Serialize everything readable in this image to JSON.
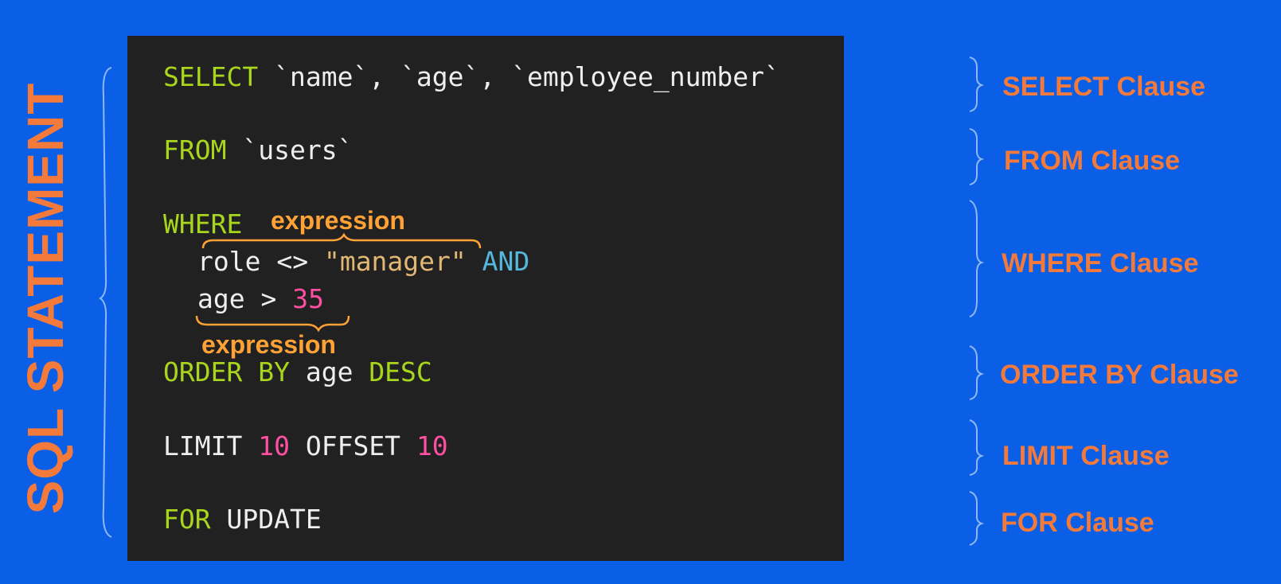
{
  "side_title": "SQL STATEMENT",
  "code": {
    "select": {
      "kw": "SELECT",
      "cols": "`name`, `age`, `employee_number`"
    },
    "from": {
      "kw": "FROM",
      "table": "`users`"
    },
    "where": {
      "kw": "WHERE",
      "cond1_left": "role <> ",
      "cond1_value": "\"manager\"",
      "cond1_logic": "AND",
      "cond2_left": "age > ",
      "cond2_value": "35"
    },
    "order_by": {
      "kw": "ORDER BY",
      "col": "age",
      "dir": "DESC"
    },
    "limit": {
      "kw": "LIMIT",
      "count": "10",
      "offset_kw": "OFFSET",
      "offset": "10"
    },
    "for_clause": {
      "kw": "FOR",
      "mode": "UPDATE"
    }
  },
  "annotations": {
    "expression_top": "expression",
    "expression_bottom": "expression"
  },
  "clauses": [
    "SELECT Clause",
    "FROM Clause",
    "WHERE Clause",
    "ORDER BY Clause",
    "LIMIT Clause",
    "FOR Clause"
  ],
  "colors": {
    "background": "#0a5fe6",
    "code_bg": "#212121",
    "accent_orange": "#f47a3c",
    "keyword_green": "#a8d61c",
    "string_tan": "#e2b774",
    "number_pink": "#ff4fa0",
    "logic_blue": "#54b8dc"
  }
}
